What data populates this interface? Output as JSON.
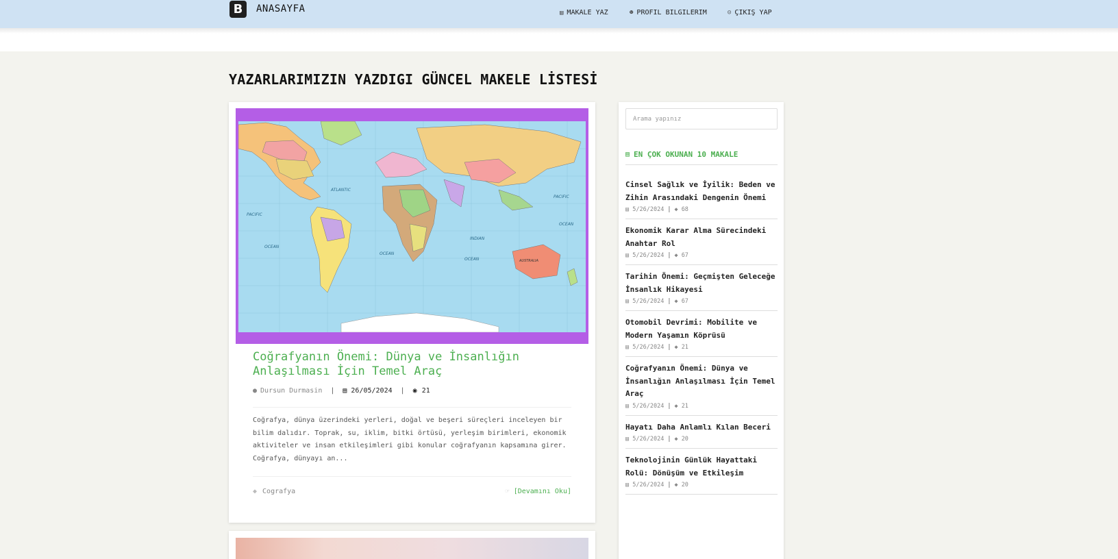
{
  "header": {
    "logo_letter": "B",
    "brand": "ANASAYFA",
    "nav": [
      {
        "icon": "book-icon",
        "glyph": "▤",
        "label": "MAKALE YAZ"
      },
      {
        "icon": "users-icon",
        "glyph": "👥",
        "label": "PROFIL BILGILERIM"
      },
      {
        "icon": "user-exit-icon",
        "glyph": "👤",
        "label": "ÇIKIŞ YAP"
      }
    ]
  },
  "main": {
    "title": "YAZARLARIMIZIN YAZDIGI GÜNCEL MAKELE LİSTESİ",
    "post": {
      "title": "Coğrafyanın Önemi: Dünya ve İnsanlığın Anlaşılması İçin Temel Araç",
      "author": "Dursun Durmasin",
      "date": "26/05/2024",
      "views": "21",
      "excerpt": "Coğrafya, dünya üzerindeki yerleri, doğal ve beşeri süreçleri inceleyen bir bilim dalıdır. Toprak, su, iklim, bitki örtüsü, yerleşim birimleri, ekonomik aktiviteler ve insan etkileşimleri gibi konular coğrafyanın kapsamına girer. Coğrafya, dünyayı an...",
      "tag": "Cografya",
      "read_more": "[Devamını Oku]",
      "image_frame_color": "#b45ee6"
    },
    "map_labels": {
      "atlantic": "ATLANTIC",
      "pacific_left": "PACIFIC",
      "pacific_right": "PACIFIC",
      "ocean_left": "OCEAN",
      "indian": "INDIAN",
      "ocean_indian": "OCEAN",
      "ocean_mid": "OCEAN",
      "ocean_right": "OCEAN",
      "australia": "AUSTRALIA"
    }
  },
  "sidebar": {
    "search_placeholder": "Arama yapınız",
    "heading": "EN ÇOK OKUNAN 10 MAKALE",
    "items": [
      {
        "title": "Cinsel Sağlık ve İyilik: Beden ve Zihin Arasındaki Dengenin Önemi",
        "date": "5/26/2024",
        "count": "68"
      },
      {
        "title": "Ekonomik Karar Alma Sürecindeki Anahtar Rol",
        "date": "5/26/2024",
        "count": "67"
      },
      {
        "title": "Tarihin Önemi: Geçmişten Geleceğe İnsanlık Hikayesi",
        "date": "5/26/2024",
        "count": "67"
      },
      {
        "title": "Otomobil Devrimi: Mobilite ve Modern Yaşamın Köprüsü",
        "date": "5/26/2024",
        "count": "21"
      },
      {
        "title": "Coğrafyanın Önemi: Dünya ve İnsanlığın Anlaşılması İçin Temel Araç",
        "date": "5/26/2024",
        "count": "21"
      },
      {
        "title": "Hayatı Daha Anlamlı Kılan Beceri",
        "date": "5/26/2024",
        "count": "20"
      },
      {
        "title": "Teknolojinin Günlük Hayattaki Rolü: Dönüşüm ve Etkileşim",
        "date": "5/26/2024",
        "count": "20"
      }
    ]
  },
  "colors": {
    "accent": "#4caf50",
    "header_bg": "#cfe2f3",
    "page_bg": "#f3f3ee"
  }
}
